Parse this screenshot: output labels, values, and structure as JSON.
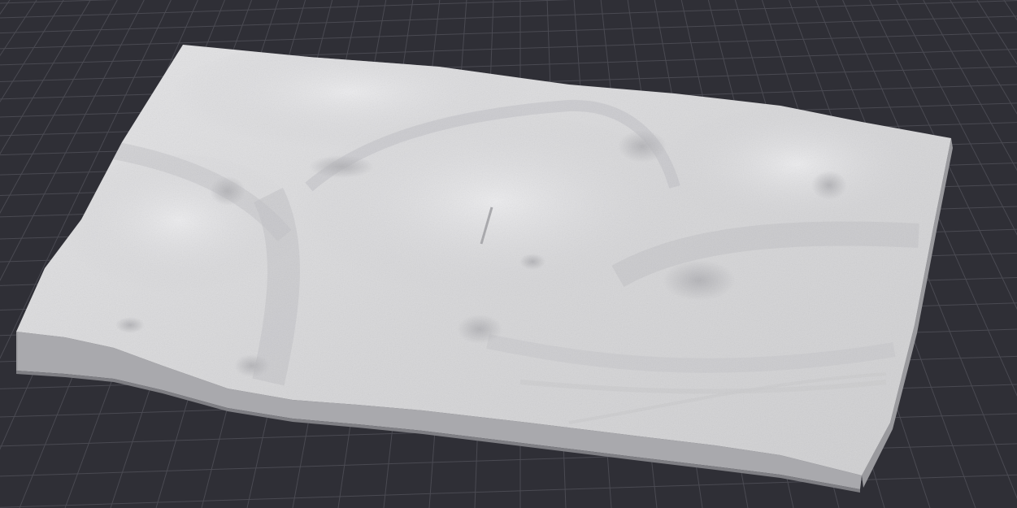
{
  "viewport": {
    "background_color": "#2f2f36",
    "grid_color": "#4a4a52",
    "grid_visible": true
  },
  "model": {
    "kind": "3D terrain relief model",
    "surface_color": "#d9d9db",
    "side_color": "#a8a8ab",
    "base_color": "#8f8f93",
    "shadow_color": "#b6b6b9"
  }
}
